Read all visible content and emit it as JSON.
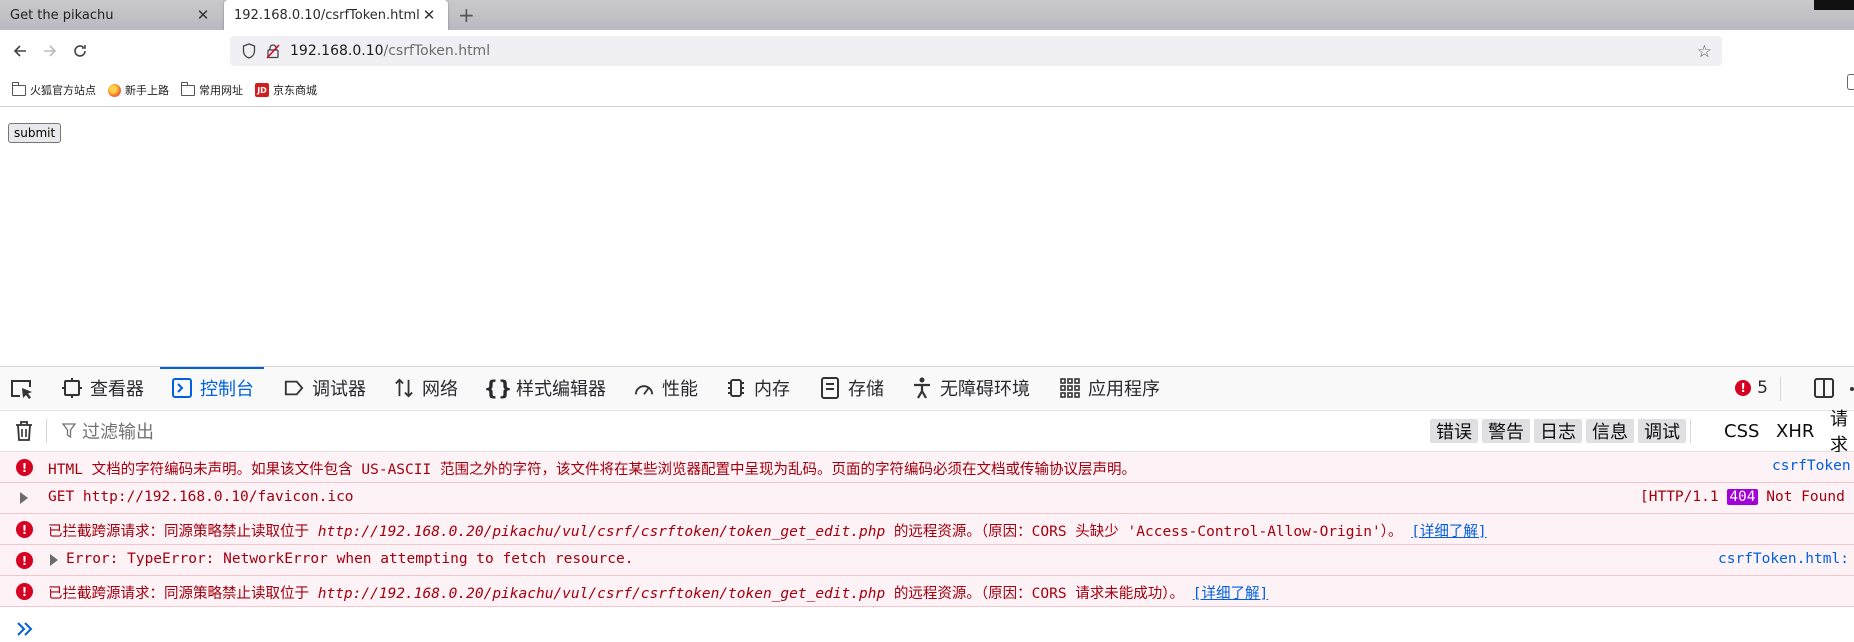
{
  "browser": {
    "tabs": [
      {
        "title": "Get the pikachu",
        "active": false
      },
      {
        "title": "192.168.0.10/csrfToken.html",
        "active": true
      }
    ],
    "new_tab_label": "+",
    "url_host": "192.168.0.10",
    "url_path": "/csrfToken.html",
    "bookmarks": [
      {
        "label": "火狐官方站点",
        "icon": "folder-icon"
      },
      {
        "label": "新手上路",
        "icon": "firefox-icon"
      },
      {
        "label": "常用网址",
        "icon": "folder-icon"
      },
      {
        "label": "京东商城",
        "icon": "jd-icon"
      }
    ],
    "jd_icon_text": "JD"
  },
  "page": {
    "submit_label": "submit"
  },
  "devtools": {
    "tabs": [
      {
        "label": "查看器",
        "icon": "inspector-icon"
      },
      {
        "label": "控制台",
        "icon": "console-icon",
        "selected": true
      },
      {
        "label": "调试器",
        "icon": "debugger-icon"
      },
      {
        "label": "网络",
        "icon": "network-icon"
      },
      {
        "label": "样式编辑器",
        "icon": "style-editor-icon"
      },
      {
        "label": "性能",
        "icon": "performance-icon"
      },
      {
        "label": "内存",
        "icon": "memory-icon"
      },
      {
        "label": "存储",
        "icon": "storage-icon"
      },
      {
        "label": "无障碍环境",
        "icon": "accessibility-icon"
      },
      {
        "label": "应用程序",
        "icon": "application-icon"
      }
    ],
    "error_count": "5",
    "filter_placeholder": "过滤输出",
    "levels": [
      "错误",
      "警告",
      "日志",
      "信息",
      "调试"
    ],
    "request_filters": [
      "CSS",
      "XHR",
      "请求"
    ],
    "messages": [
      {
        "text": "HTML 文档的字符编码未声明。如果该文件包含 US-ASCII 范围之外的字符，该文件将在某些浏览器配置中呈现为乱码。页面的字符编码必须在文档或传输协议层声明。",
        "source": "csrfToken"
      },
      {
        "text": "GET http://192.168.0.10/favicon.ico",
        "http_prefix": "[HTTP/1.1",
        "status": "404",
        "http_suffix": "Not Found"
      },
      {
        "prefix": "已拦截跨源请求：同源策略禁止读取位于 ",
        "url": "http://192.168.0.20/pikachu/vul/csrf/csrftoken/token_get_edit.php",
        "suffix": " 的远程资源。（原因：CORS 头缺少 'Access-Control-Allow-Origin'）。",
        "learn_more": "[详细了解]"
      },
      {
        "text": "Error: TypeError: NetworkError when attempting to fetch resource.",
        "source": "csrfToken.html:"
      },
      {
        "prefix": "已拦截跨源请求：同源策略禁止读取位于 ",
        "url": "http://192.168.0.20/pikachu/vul/csrf/csrftoken/token_get_edit.php",
        "suffix": " 的远程资源。（原因：CORS 请求未能成功）。",
        "learn_more": "[详细了解]"
      }
    ]
  },
  "colors": {
    "accent": "#0060df",
    "error": "#d70022",
    "error_text": "#a4000f",
    "error_bg": "#fdf2f5",
    "status_404": "#a200db"
  }
}
